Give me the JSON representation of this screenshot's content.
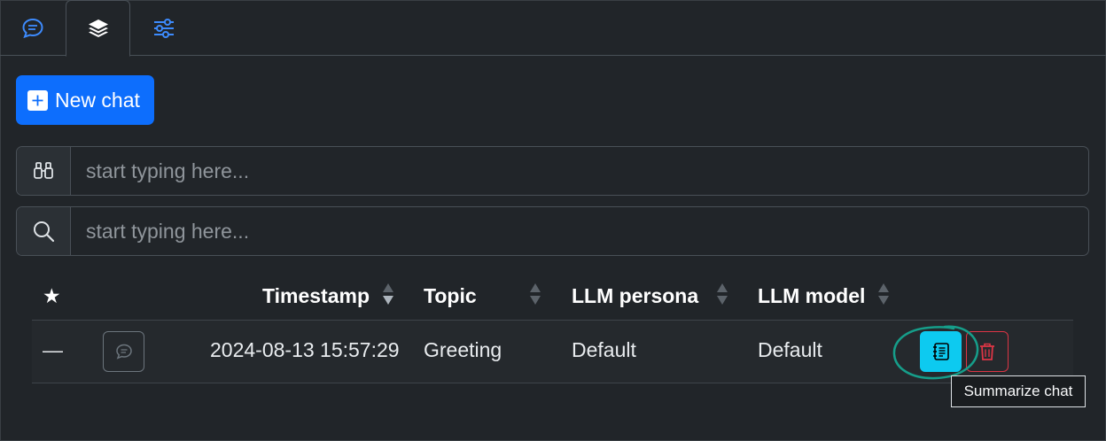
{
  "tabs": [
    {
      "icon": "chat-bubble-icon",
      "active": false
    },
    {
      "icon": "layers-icon",
      "active": true
    },
    {
      "icon": "sliders-icon",
      "active": false
    }
  ],
  "new_chat_label": "New chat",
  "filters": [
    {
      "icon": "binoculars-icon",
      "placeholder": "start typing here..."
    },
    {
      "icon": "search-icon",
      "placeholder": "start typing here..."
    }
  ],
  "table": {
    "headers": {
      "star": "★",
      "timestamp": "Timestamp",
      "topic": "Topic",
      "persona": "LLM persona",
      "model": "LLM model"
    },
    "rows": [
      {
        "star": "—",
        "timestamp": "2024-08-13 15:57:29",
        "topic": "Greeting",
        "persona": "Default",
        "model": "Default"
      }
    ]
  },
  "tooltip": "Summarize chat",
  "colors": {
    "background": "#212529",
    "primary": "#0d6efd",
    "info": "#0dcaf0",
    "danger": "#dc3545",
    "highlight": "#169e8a"
  }
}
